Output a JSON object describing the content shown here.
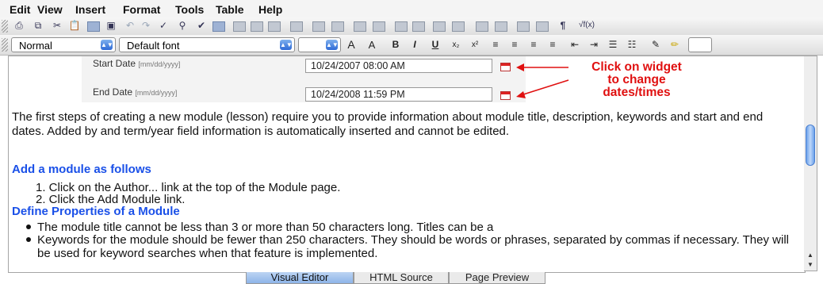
{
  "menu": {
    "items": [
      "Edit",
      "View",
      "Insert",
      "Format",
      "Tools",
      "Table",
      "Help"
    ]
  },
  "format_bar": {
    "style_value": "Normal",
    "font_value": "Default font",
    "size_value": "",
    "glyphs": [
      "A",
      "A",
      "B",
      "I",
      "U",
      "x₂",
      "x²"
    ]
  },
  "toolbar": {
    "pilcrow": "¶",
    "formula": "√f(x)"
  },
  "dates": {
    "start_label": "Start Date",
    "start_hint": "[mm/dd/yyyy]",
    "start_value": "10/24/2007 08:00 AM",
    "end_label": "End Date",
    "end_hint": "[mm/dd/yyyy]",
    "end_value": "10/24/2008 11:59 PM"
  },
  "annotation": {
    "line1": "Click on widget",
    "line2": "to change",
    "line3": "dates/times"
  },
  "body": {
    "intro": "The first steps of creating a new module (lesson) require you to provide information about module title, description, keywords and start and end dates. Added by and term/year field information is automatically inserted and cannot be edited.",
    "heading1": "Add a module as follows",
    "steps": [
      "1. Click on the Author... link at the top of the Module page.",
      "2. Click the Add Module link."
    ],
    "heading2": "Define Properties of a Module",
    "bullets": [
      "The module title cannot be less than 3 or more than 50 characters long. Titles can be a",
      "Keywords for the module should be fewer than 250 characters. They should be words or phrases, separated by commas if necessary. They will be used for keyword searches when that feature is implemented."
    ]
  },
  "tabs": [
    "Visual Editor",
    "HTML Source",
    "Page Preview"
  ],
  "colors": {
    "accent": "#1a50e8",
    "annotation": "#e01010",
    "tab_active": "#8db4e8"
  }
}
